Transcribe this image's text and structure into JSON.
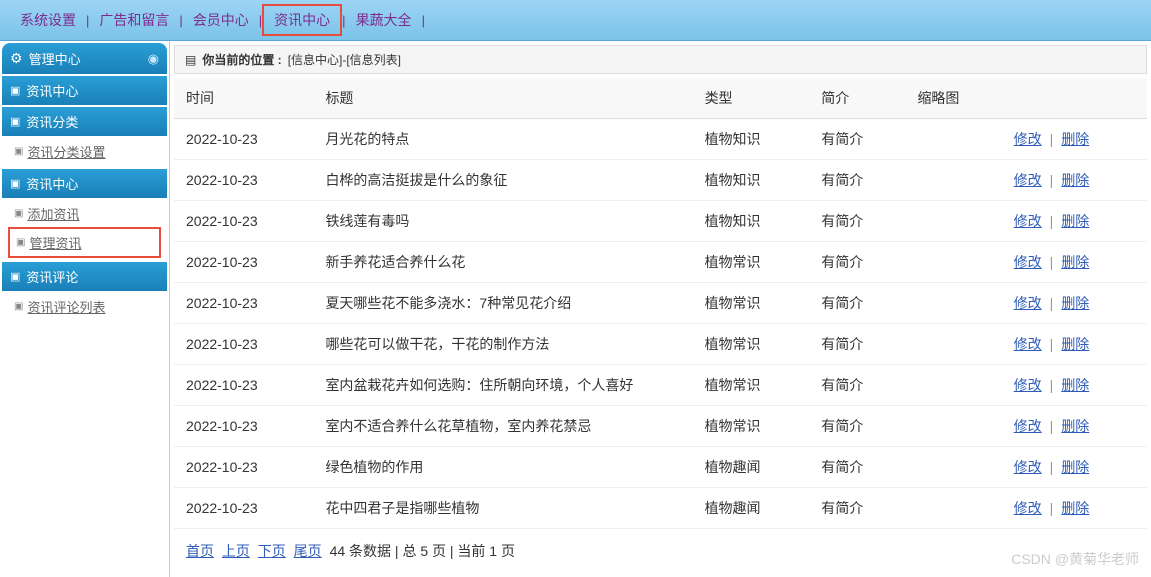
{
  "topNav": {
    "items": [
      {
        "label": "系统设置",
        "highlighted": false
      },
      {
        "label": "广告和留言",
        "highlighted": false
      },
      {
        "label": "会员中心",
        "highlighted": false
      },
      {
        "label": "资讯中心",
        "highlighted": true
      },
      {
        "label": "果蔬大全",
        "highlighted": false
      }
    ]
  },
  "sidebar": {
    "mainHeader": "管理中心",
    "sections": [
      {
        "title": "资讯中心",
        "isMainSub": true,
        "items": []
      },
      {
        "title": "资讯分类",
        "items": [
          {
            "label": "资讯分类设置",
            "highlighted": false
          }
        ]
      },
      {
        "title": "资讯中心",
        "items": [
          {
            "label": "添加资讯",
            "highlighted": false
          },
          {
            "label": "管理资讯",
            "highlighted": true
          }
        ]
      },
      {
        "title": "资讯评论",
        "items": [
          {
            "label": "资讯评论列表",
            "highlighted": false
          }
        ]
      }
    ]
  },
  "breadcrumb": {
    "label": "你当前的位置 :",
    "path": "[信息中心]-[信息列表]"
  },
  "table": {
    "headers": [
      "时间",
      "标题",
      "类型",
      "简介",
      "缩略图",
      ""
    ],
    "actions": {
      "edit": "修改",
      "delete": "删除"
    },
    "rows": [
      {
        "time": "2022-10-23",
        "title": "月光花的特点",
        "type": "植物知识",
        "intro": "有简介"
      },
      {
        "time": "2022-10-23",
        "title": "白桦的高洁挺拔是什么的象征",
        "type": "植物知识",
        "intro": "有简介"
      },
      {
        "time": "2022-10-23",
        "title": "铁线莲有毒吗",
        "type": "植物知识",
        "intro": "有简介"
      },
      {
        "time": "2022-10-23",
        "title": "新手养花适合养什么花",
        "type": "植物常识",
        "intro": "有简介"
      },
      {
        "time": "2022-10-23",
        "title": "夏天哪些花不能多浇水：7种常见花介绍",
        "type": "植物常识",
        "intro": "有简介"
      },
      {
        "time": "2022-10-23",
        "title": "哪些花可以做干花，干花的制作方法",
        "type": "植物常识",
        "intro": "有简介"
      },
      {
        "time": "2022-10-23",
        "title": "室内盆栽花卉如何选购：住所朝向环境，个人喜好",
        "type": "植物常识",
        "intro": "有简介"
      },
      {
        "time": "2022-10-23",
        "title": "室内不适合养什么花草植物，室内养花禁忌",
        "type": "植物常识",
        "intro": "有简介"
      },
      {
        "time": "2022-10-23",
        "title": "绿色植物的作用",
        "type": "植物趣闻",
        "intro": "有简介"
      },
      {
        "time": "2022-10-23",
        "title": "花中四君子是指哪些植物",
        "type": "植物趣闻",
        "intro": "有简介"
      }
    ]
  },
  "pagination": {
    "first": "首页",
    "prev": "上页",
    "next": "下页",
    "last": "尾页",
    "info": "44 条数据 | 总 5 页 | 当前 1 页"
  },
  "watermark": "CSDN @黄菊华老师"
}
